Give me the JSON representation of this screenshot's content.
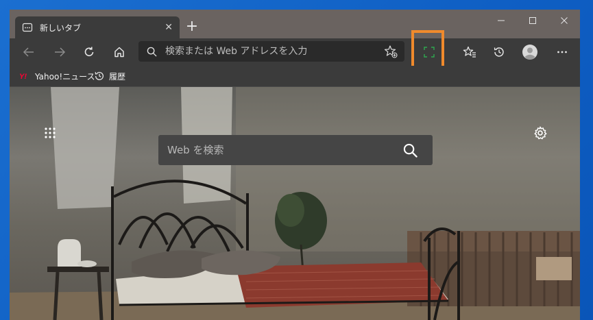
{
  "tab": {
    "title": "新しいタブ",
    "close": "✕"
  },
  "newtab": "+",
  "address": {
    "placeholder": "検索または Web アドレスを入力"
  },
  "favorites": [
    {
      "label": "Yahoo!ニュース",
      "icon": "yahoo-logo-icon"
    },
    {
      "label": "履歴",
      "icon": "history-icon"
    }
  ],
  "search": {
    "placeholder": "Web を検索"
  },
  "colors": {
    "highlight": "#f08a2c",
    "titlebar": "#6a6360",
    "toolbar": "#3b3b3b",
    "desktop": "#1b6fd0"
  }
}
